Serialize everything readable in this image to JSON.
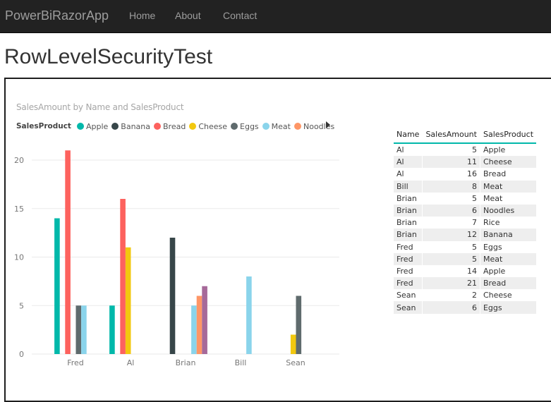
{
  "navbar": {
    "brand": "PowerBiRazorApp",
    "links": [
      "Home",
      "About",
      "Contact"
    ]
  },
  "page": {
    "title": "RowLevelSecurityTest"
  },
  "report": {
    "chart_title": "SalesAmount by Name and SalesProduct",
    "legend_title": "SalesProduct",
    "legend_more_icon": "triangle-right-icon"
  },
  "colors": {
    "Apple": "#01b8aa",
    "Banana": "#374649",
    "Bread": "#fd625e",
    "Cheese": "#f2c80f",
    "Eggs": "#5f6b6d",
    "Meat": "#8ad4eb",
    "Noodles": "#fe9666",
    "Rice": "#a66999"
  },
  "chart_data": {
    "type": "bar",
    "title": "SalesAmount by Name and SalesProduct",
    "xlabel": "",
    "ylabel": "",
    "categories": [
      "Fred",
      "Al",
      "Brian",
      "Bill",
      "Sean"
    ],
    "legend": [
      "Apple",
      "Banana",
      "Bread",
      "Cheese",
      "Eggs",
      "Meat",
      "Noodles"
    ],
    "legend_position": "top-left",
    "yticks": [
      0,
      5,
      10,
      15,
      20
    ],
    "ylim": [
      0,
      22
    ],
    "grid": true,
    "series": [
      {
        "name": "Apple",
        "values": [
          14,
          5,
          null,
          null,
          null
        ]
      },
      {
        "name": "Banana",
        "values": [
          null,
          null,
          12,
          null,
          null
        ]
      },
      {
        "name": "Bread",
        "values": [
          21,
          16,
          null,
          null,
          null
        ]
      },
      {
        "name": "Cheese",
        "values": [
          null,
          11,
          null,
          null,
          2
        ]
      },
      {
        "name": "Eggs",
        "values": [
          5,
          null,
          null,
          null,
          6
        ]
      },
      {
        "name": "Meat",
        "values": [
          5,
          null,
          5,
          8,
          null
        ]
      },
      {
        "name": "Noodles",
        "values": [
          null,
          null,
          6,
          null,
          null
        ]
      },
      {
        "name": "Rice",
        "values": [
          null,
          null,
          7,
          null,
          null
        ]
      }
    ]
  },
  "table": {
    "columns": [
      "Name",
      "SalesAmount",
      "SalesProduct"
    ],
    "rows": [
      [
        "Al",
        "5",
        "Apple"
      ],
      [
        "Al",
        "11",
        "Cheese"
      ],
      [
        "Al",
        "16",
        "Bread"
      ],
      [
        "Bill",
        "8",
        "Meat"
      ],
      [
        "Brian",
        "5",
        "Meat"
      ],
      [
        "Brian",
        "6",
        "Noodles"
      ],
      [
        "Brian",
        "7",
        "Rice"
      ],
      [
        "Brian",
        "12",
        "Banana"
      ],
      [
        "Fred",
        "5",
        "Eggs"
      ],
      [
        "Fred",
        "5",
        "Meat"
      ],
      [
        "Fred",
        "14",
        "Apple"
      ],
      [
        "Fred",
        "21",
        "Bread"
      ],
      [
        "Sean",
        "2",
        "Cheese"
      ],
      [
        "Sean",
        "6",
        "Eggs"
      ]
    ]
  }
}
